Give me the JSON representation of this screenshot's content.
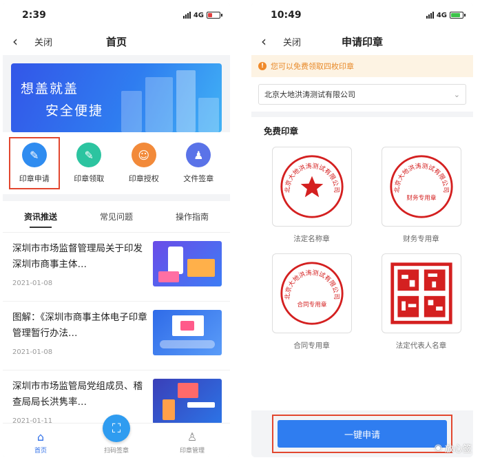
{
  "left": {
    "status": {
      "time": "2:39",
      "network": "4G"
    },
    "nav": {
      "close": "关闭",
      "title": "首页"
    },
    "banner": {
      "line1": "想盖就盖",
      "line2": "安全便捷"
    },
    "quick_menu": [
      {
        "label": "印章申请",
        "icon": "seal-apply-icon",
        "color": "#2f8cf0"
      },
      {
        "label": "印章领取",
        "icon": "seal-receive-icon",
        "color": "#2cc4a0"
      },
      {
        "label": "印章授权",
        "icon": "seal-authorize-icon",
        "color": "#f28a3a"
      },
      {
        "label": "文件签章",
        "icon": "file-sign-icon",
        "color": "#5a73e8"
      }
    ],
    "news_tabs": [
      "资讯推送",
      "常见问题",
      "操作指南"
    ],
    "news": [
      {
        "title": "深圳市市场监督管理局关于印发深圳市商事主体…",
        "date": "2021-01-08"
      },
      {
        "title": "图解：《深圳市商事主体电子印章管理暂行办法…",
        "date": "2021-01-08"
      },
      {
        "title": "深圳市市场监管局党组成员、稽查局局长洪隽率…",
        "date": "2021-01-11"
      }
    ],
    "tabbar": {
      "home": "首页",
      "scan": "扫码签章",
      "manage": "印章管理"
    }
  },
  "right": {
    "status": {
      "time": "10:49",
      "network": "4G"
    },
    "nav": {
      "close": "关闭",
      "title": "申请印章"
    },
    "notice": "您可以免费领取四枚印章",
    "company": "北京大地洪涛测试有限公司",
    "section_title": "免费印章",
    "seals": [
      {
        "label": "法定名称章",
        "type": "round-star"
      },
      {
        "label": "财务专用章",
        "type": "round-finance"
      },
      {
        "label": "合同专用章",
        "type": "round-contract"
      },
      {
        "label": "法定代表人名章",
        "type": "square"
      }
    ],
    "seal_text": {
      "company": "北京大地洪涛测试有限公司",
      "finance": "财务专用章",
      "contract": "合同专用章"
    },
    "apply_button": "一键申请"
  },
  "watermark": "放心签",
  "colors": {
    "primary": "#2f7df0",
    "highlight": "#e2462e",
    "seal_red": "#d42020",
    "notice": "#e88a2a"
  }
}
